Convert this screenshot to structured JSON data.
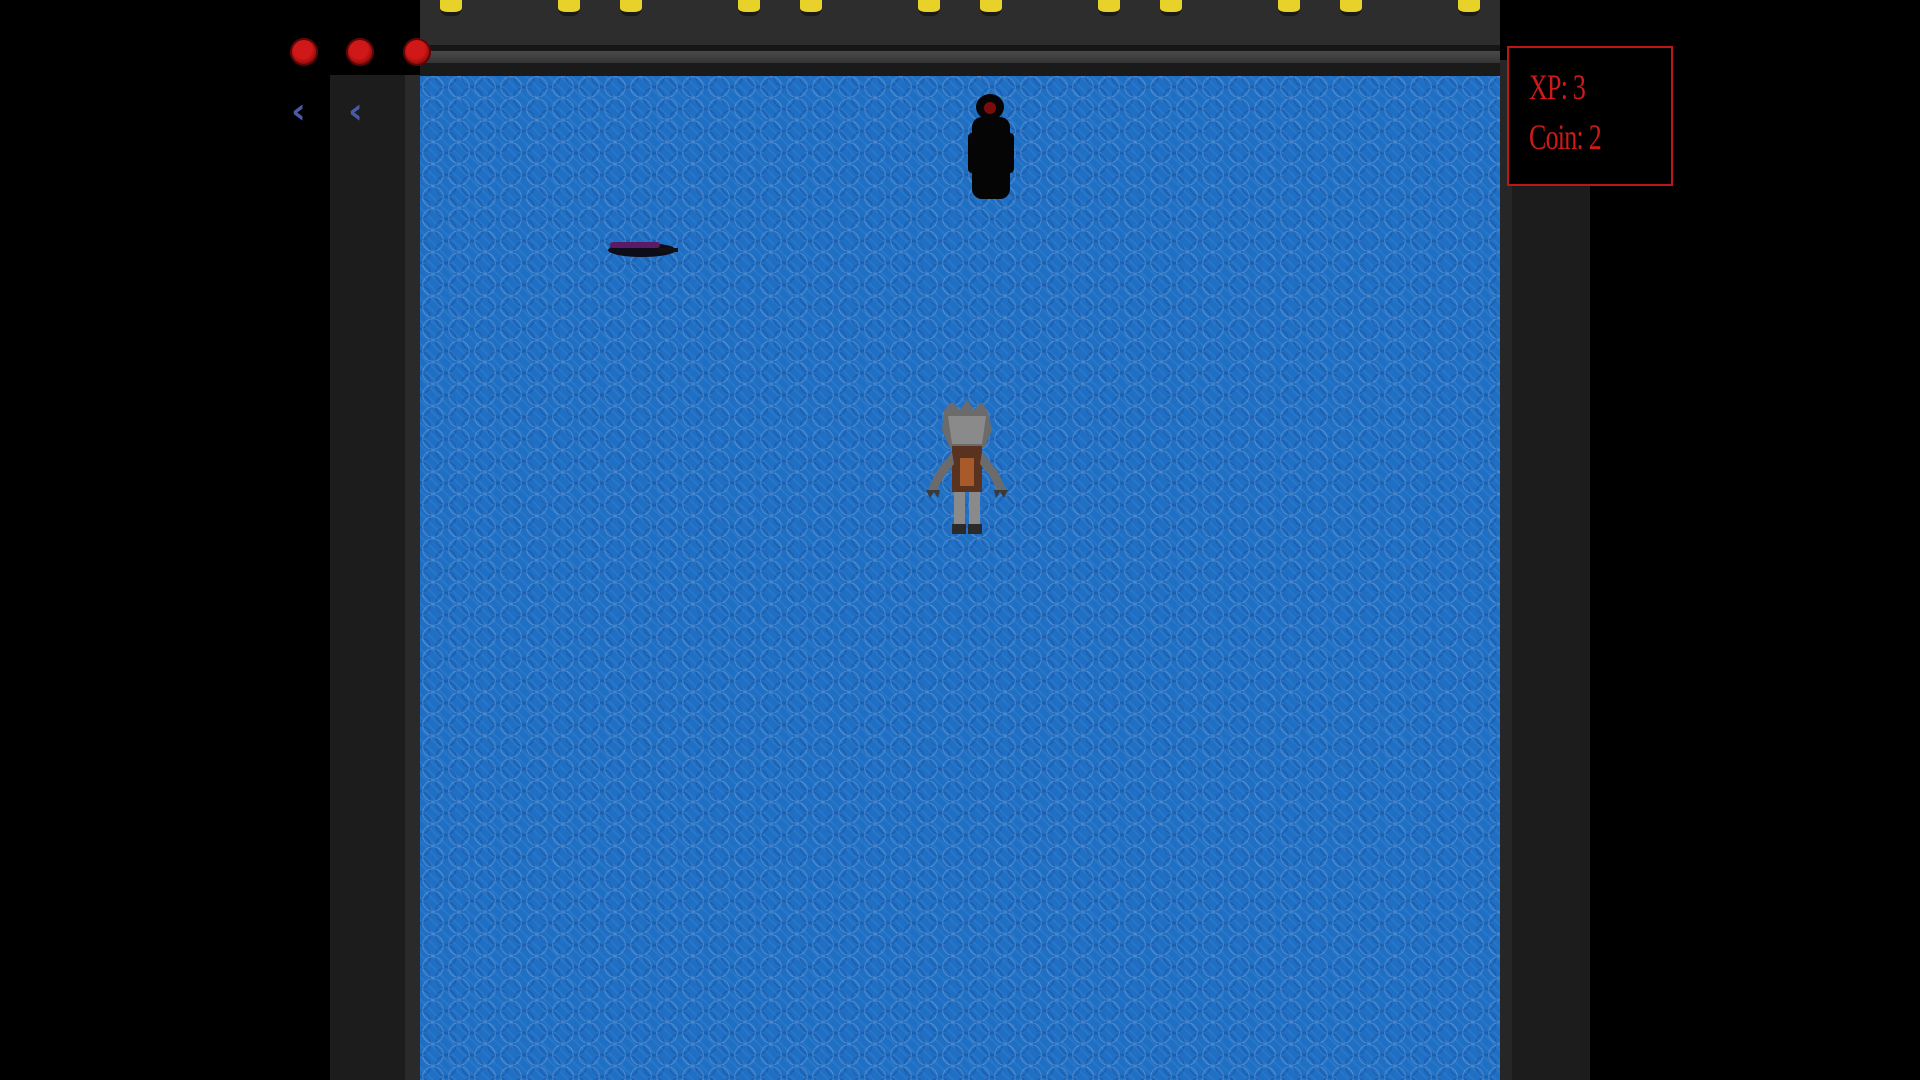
{
  "hud": {
    "hearts": {
      "current": 3,
      "max": 3,
      "icon": "heart-icon",
      "color": "#d01818"
    },
    "inventory_arrows": {
      "count": 2,
      "icon": "chevron-left-icon",
      "color": "#4a5aa6"
    },
    "stats": {
      "xp_label": "XP: 3",
      "coin_label": "Coin: 2",
      "color": "#d01a1a"
    }
  },
  "scene": {
    "floor": "water",
    "water_color": "#1f6fc4",
    "lamp_color": "#e8d22a",
    "entities": {
      "enemy": "shadow-figure",
      "item": "floating-item",
      "player": "werewolf-player"
    }
  }
}
